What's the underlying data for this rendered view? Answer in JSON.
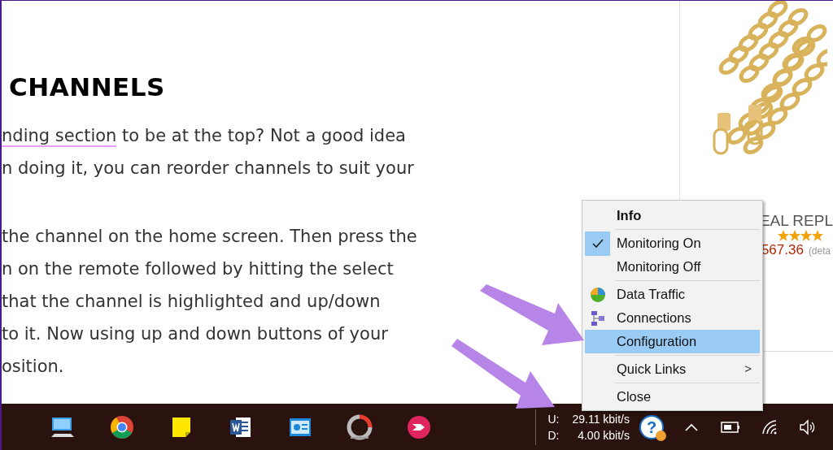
{
  "article": {
    "heading": "CHANNELS",
    "paragraphs": [
      [
        {
          "link": "nding section",
          "text": " to be at the top? Not a good idea"
        },
        {
          "text": "n doing it, you can reorder channels to suit your"
        }
      ],
      [
        {
          "text": "the channel on the home screen. Then press the"
        },
        {
          "text": "n on the remote followed by hitting the select"
        },
        {
          "text": "that the channel is highlighted and up/down"
        },
        {
          "text": "to it. Now using up and down buttons of your"
        },
        {
          "text": "osition."
        }
      ]
    ]
  },
  "product": {
    "title": "EAL REPL",
    "stars": 4,
    "price": "567.36",
    "note": "(deta"
  },
  "menu": {
    "items": [
      {
        "kind": "header",
        "label": "Info"
      },
      {
        "kind": "separator"
      },
      {
        "kind": "item",
        "label": "Monitoring On",
        "checked": true,
        "selected": false
      },
      {
        "kind": "item",
        "label": "Monitoring Off",
        "checked": false,
        "selected": false
      },
      {
        "kind": "separator"
      },
      {
        "kind": "item",
        "label": "Data Traffic",
        "icon": true,
        "selected": false
      },
      {
        "kind": "item",
        "label": "Connections",
        "icon": true,
        "selected": false
      },
      {
        "kind": "item",
        "label": "Configuration",
        "selected": true
      },
      {
        "kind": "separator"
      },
      {
        "kind": "submenu",
        "label": "Quick Links",
        "arrow": ">",
        "selected": false
      },
      {
        "kind": "separator"
      },
      {
        "kind": "item",
        "label": "Close",
        "selected": false
      }
    ]
  },
  "tray": {
    "upload_label": "U:",
    "upload_rate": "29.11 kbit/s",
    "download_label": "D:",
    "download_rate": "4.00 kbit/s",
    "help_glyph": "?"
  }
}
